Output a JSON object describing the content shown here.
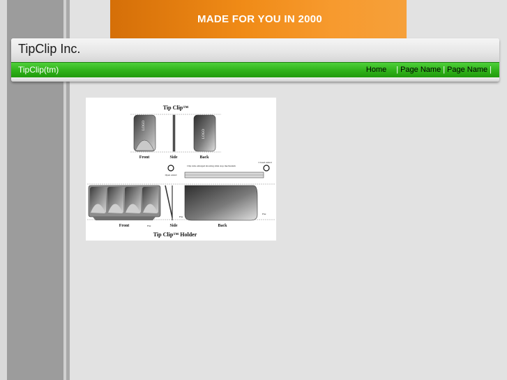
{
  "banner": {
    "text": "MADE FOR YOU IN 2000"
  },
  "header": {
    "site_title": "TipClip Inc."
  },
  "nav": {
    "brand": "TipClip(tm)",
    "links": [
      "Home",
      "Page Name",
      "Page Name"
    ]
  },
  "image": {
    "title_top": "Tip Clip™",
    "labels_top": [
      "Front",
      "Side",
      "Back"
    ],
    "logo_text": "LOGO",
    "callouts": [
      "Clip tube enlarged showing slide stop mechanism",
      "Open ended",
      "Closed ended",
      "Flat",
      "Flat",
      "Flat"
    ],
    "labels_bottom": [
      "Front",
      "Side",
      "Back"
    ],
    "title_bottom": "Tip Clip™ Holder"
  },
  "colors": {
    "banner_orange": "#f08b17",
    "nav_green": "#2fb119",
    "background": "#e2e2e2"
  }
}
